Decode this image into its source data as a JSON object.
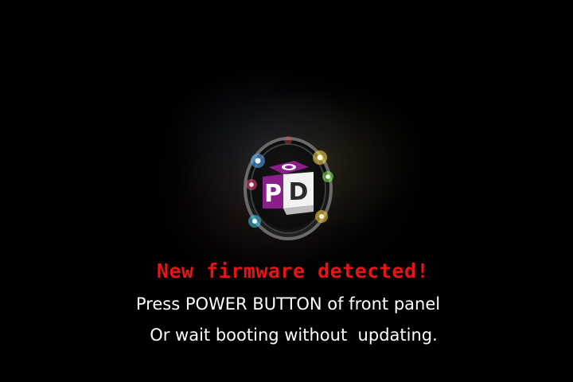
{
  "logo": {
    "letters": [
      "P",
      "D"
    ],
    "top_glyph": "O"
  },
  "message": {
    "headline": "New firmware detected!",
    "line1": "Press POWER BUTTON of front panel",
    "line2": "Or wait booting without  updating."
  },
  "colors": {
    "background": "#000000",
    "headline": "#e81414",
    "body_text": "#ffffff",
    "cube_purple": "#8a1f8a",
    "cube_dark": "#2b2b2b",
    "cube_light": "#f2f2f2"
  }
}
